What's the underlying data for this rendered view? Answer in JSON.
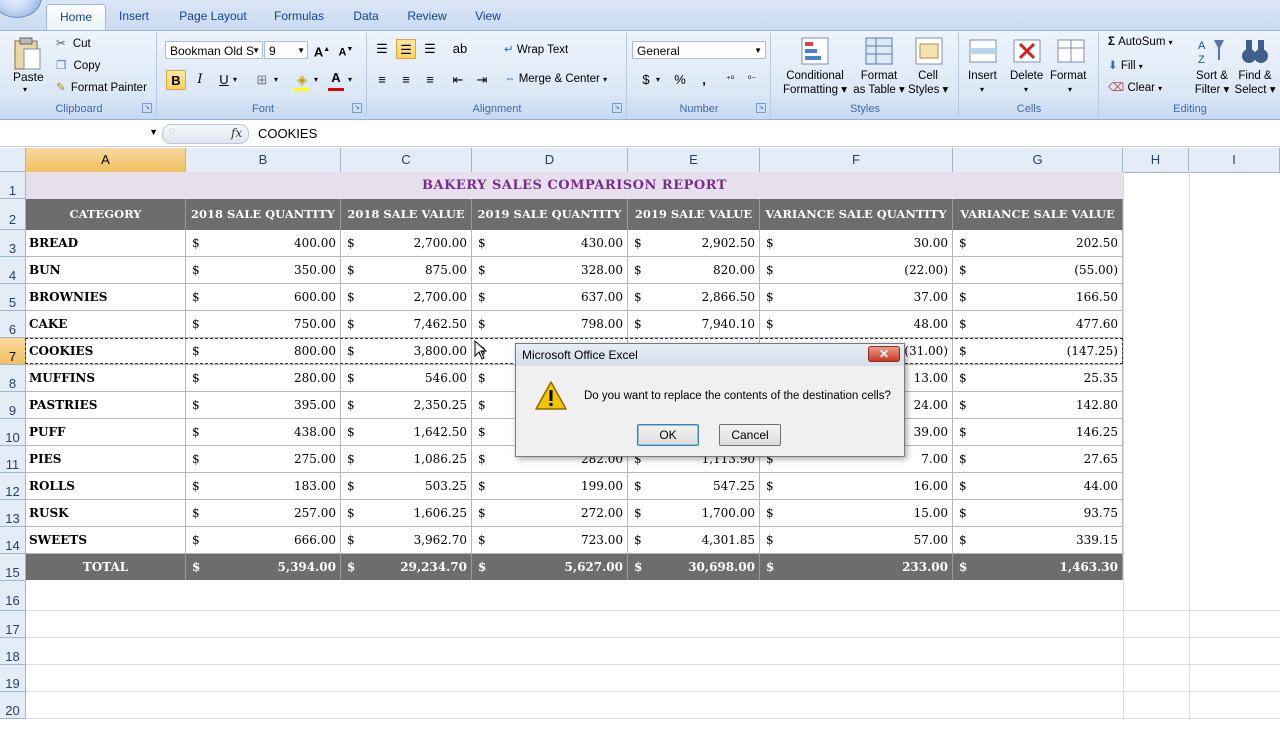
{
  "ribbon": {
    "tabs": [
      "Home",
      "Insert",
      "Page Layout",
      "Formulas",
      "Data",
      "Review",
      "View"
    ],
    "active_tab": "Home",
    "clipboard": {
      "paste": "Paste",
      "cut": "Cut",
      "copy": "Copy",
      "format_painter": "Format Painter",
      "label": "Clipboard"
    },
    "font": {
      "family": "Bookman Old S",
      "size": "9",
      "bold": "B",
      "italic": "I",
      "underline": "U",
      "label": "Font"
    },
    "alignment": {
      "wrap_text": "Wrap Text",
      "merge_center": "Merge & Center",
      "label": "Alignment"
    },
    "number": {
      "format": "General",
      "currency": "$",
      "percent": "%",
      "comma": ",",
      "label": "Number"
    },
    "styles": {
      "conditional": [
        "Conditional",
        "Formatting"
      ],
      "format_table": [
        "Format",
        "as Table"
      ],
      "cell_styles": [
        "Cell",
        "Styles"
      ],
      "label": "Styles"
    },
    "cells": {
      "insert": "Insert",
      "delete": "Delete",
      "format": "Format",
      "label": "Cells"
    },
    "editing": {
      "autosum": "AutoSum",
      "fill": "Fill",
      "clear": "Clear",
      "sort_filter": [
        "Sort &",
        "Filter"
      ],
      "find_select": [
        "Find &",
        "Select"
      ],
      "label": "Editing"
    }
  },
  "formula_bar": {
    "fx": "fx",
    "content": "COOKIES"
  },
  "columns": [
    "A",
    "B",
    "C",
    "D",
    "E",
    "F",
    "G",
    "H",
    "I"
  ],
  "rows": [
    "1",
    "2",
    "3",
    "4",
    "5",
    "6",
    "7",
    "8",
    "9",
    "10",
    "11",
    "12",
    "13",
    "14",
    "15",
    "16",
    "17",
    "18",
    "19",
    "20"
  ],
  "sheet": {
    "title": "BAKERY SALES COMPARISON REPORT",
    "headers": [
      "CATEGORY",
      "2018 SALE QUANTITY",
      "2018 SALE VALUE",
      "2019 SALE QUANTITY",
      "2019 SALE VALUE",
      "VARIANCE SALE QUANTITY",
      "VARIANCE SALE VALUE"
    ],
    "currency_symbol": "$",
    "rows": [
      [
        "BREAD",
        "400.00",
        "2,700.00",
        "430.00",
        "2,902.50",
        "30.00",
        "202.50"
      ],
      [
        "BUN",
        "350.00",
        "875.00",
        "328.00",
        "820.00",
        "(22.00)",
        "(55.00)"
      ],
      [
        "BROWNIES",
        "600.00",
        "2,700.00",
        "637.00",
        "2,866.50",
        "37.00",
        "166.50"
      ],
      [
        "CAKE",
        "750.00",
        "7,462.50",
        "798.00",
        "7,940.10",
        "48.00",
        "477.60"
      ],
      [
        "COOKIES",
        "800.00",
        "3,800.00",
        "",
        "",
        "(31.00)",
        "(147.25)"
      ],
      [
        "MUFFINS",
        "280.00",
        "546.00",
        "",
        "",
        "13.00",
        "25.35"
      ],
      [
        "PASTRIES",
        "395.00",
        "2,350.25",
        "",
        "",
        "24.00",
        "142.80"
      ],
      [
        "PUFF",
        "438.00",
        "1,642.50",
        "",
        "",
        "39.00",
        "146.25"
      ],
      [
        "PIES",
        "275.00",
        "1,086.25",
        "282.00",
        "1,113.90",
        "7.00",
        "27.65"
      ],
      [
        "ROLLS",
        "183.00",
        "503.25",
        "199.00",
        "547.25",
        "16.00",
        "44.00"
      ],
      [
        "RUSK",
        "257.00",
        "1,606.25",
        "272.00",
        "1,700.00",
        "15.00",
        "93.75"
      ],
      [
        "SWEETS",
        "666.00",
        "3,962.70",
        "723.00",
        "4,301.85",
        "57.00",
        "339.15"
      ]
    ],
    "total": [
      "TOTAL",
      "5,394.00",
      "29,234.70",
      "5,627.00",
      "30,698.00",
      "233.00",
      "1,463.30"
    ]
  },
  "dialog": {
    "title": "Microsoft Office Excel",
    "message": "Do you want to replace the contents of the destination cells?",
    "ok": "OK",
    "cancel": "Cancel",
    "close": "✕"
  }
}
